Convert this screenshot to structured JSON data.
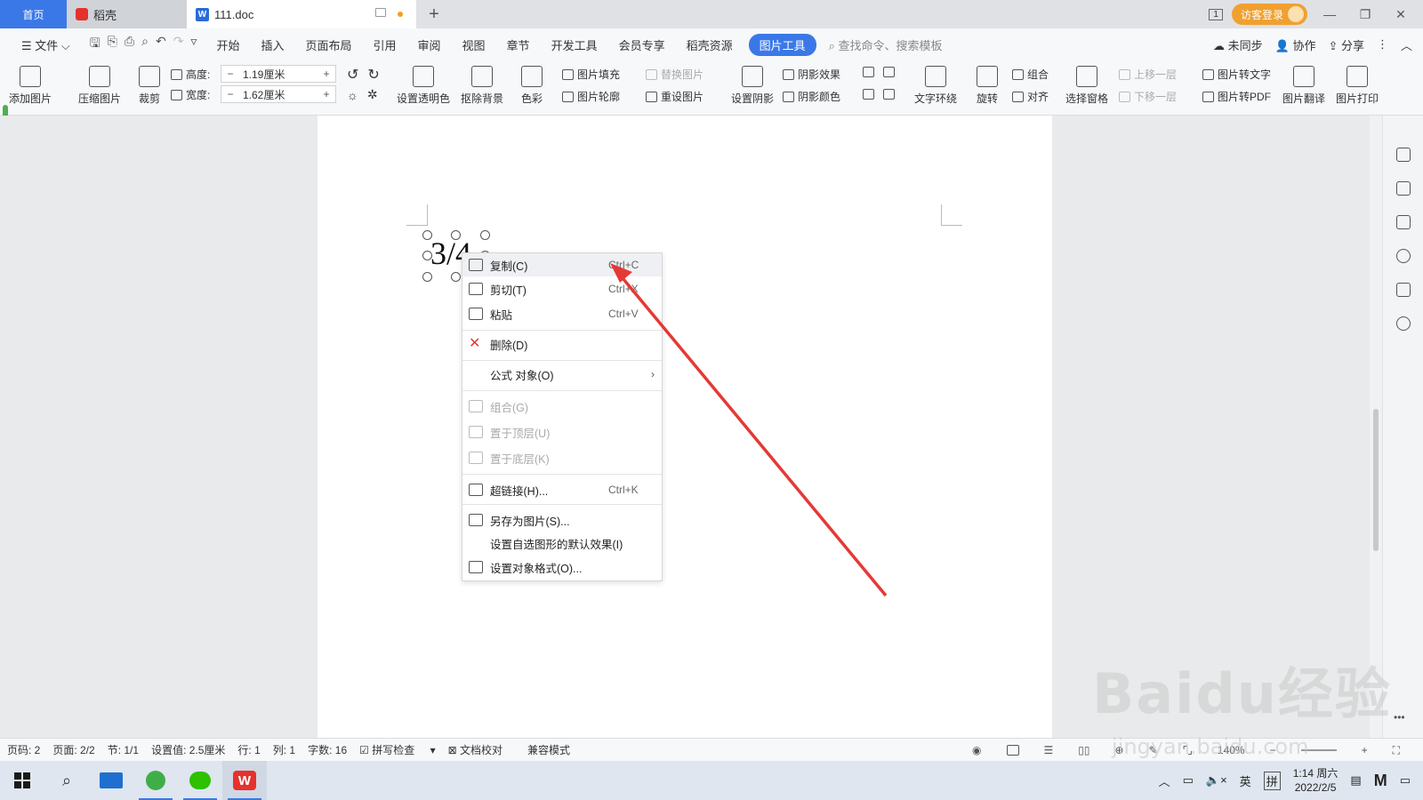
{
  "titlebar": {
    "home_tab": "首页",
    "daoke_tab": "稻壳",
    "doc_tab": "111.doc",
    "visitor_login": "访客登录",
    "window_badge": "1"
  },
  "menubar": {
    "file": "文件",
    "items": [
      "开始",
      "插入",
      "页面布局",
      "引用",
      "审阅",
      "视图",
      "章节",
      "开发工具",
      "会员专享",
      "稻壳资源"
    ],
    "active_tab": "图片工具",
    "search": "查找命令、搜索模板",
    "unsync": "未同步",
    "collab": "协作",
    "share": "分享"
  },
  "ribbon": {
    "add_picture": "添加图片",
    "compress_picture": "压缩图片",
    "crop": "裁剪",
    "height_label": "高度:",
    "height_value": "1.19厘米",
    "width_label": "宽度:",
    "width_value": "1.62厘米",
    "set_transparent": "设置透明色",
    "remove_bg": "抠除背景",
    "color": "色彩",
    "picture_fill": "图片填充",
    "picture_outline": "图片轮廓",
    "replace_picture": "替换图片",
    "reset_picture": "重设图片",
    "set_shadow": "设置阴影",
    "shadow_effect": "阴影效果",
    "shadow_color": "阴影颜色",
    "text_wrap": "文字环绕",
    "rotate": "旋转",
    "group": "组合",
    "align": "对齐",
    "selection_pane": "选择窗格",
    "bring_forward": "上移一层",
    "send_backward": "下移一层",
    "pic_to_text": "图片转文字",
    "pic_to_pdf": "图片转PDF",
    "pic_translate": "图片翻译",
    "pic_print": "图片打印"
  },
  "document": {
    "equation_text": "3/4"
  },
  "context_menu": {
    "items": [
      {
        "label": "复制(C)",
        "shortcut": "Ctrl+C"
      },
      {
        "label": "剪切(T)",
        "shortcut": "Ctrl+X"
      },
      {
        "label": "粘贴",
        "shortcut": "Ctrl+V"
      },
      {
        "label": "删除(D)",
        "shortcut": ""
      },
      {
        "label": "公式 对象(O)",
        "shortcut": ""
      },
      {
        "label": "组合(G)",
        "shortcut": ""
      },
      {
        "label": "置于顶层(U)",
        "shortcut": ""
      },
      {
        "label": "置于底层(K)",
        "shortcut": ""
      },
      {
        "label": "超链接(H)...",
        "shortcut": "Ctrl+K"
      },
      {
        "label": "另存为图片(S)...",
        "shortcut": ""
      },
      {
        "label": "设置自选图形的默认效果(I)",
        "shortcut": ""
      },
      {
        "label": "设置对象格式(O)...",
        "shortcut": ""
      }
    ]
  },
  "statusbar": {
    "page_code": "页码: 2",
    "pages": "页面: 2/2",
    "section": "节: 1/1",
    "setting": "设置值: 2.5厘米",
    "row": "行: 1",
    "col": "列: 1",
    "word_count": "字数: 16",
    "spell_check": "拼写检查",
    "doc_proof": "文档校对",
    "compat_mode": "兼容模式",
    "zoom": "140%"
  },
  "taskbar": {
    "ime_lang": "英",
    "ime_mode": "拼",
    "time": "1:14 周六",
    "date": "2022/2/5"
  },
  "watermark": {
    "brand": "Baidu经验",
    "url": "jingyan.baidu.com"
  },
  "colors": {
    "accent": "#3b78e7",
    "arrow": "#e53935",
    "visitor": "#f0a030"
  }
}
